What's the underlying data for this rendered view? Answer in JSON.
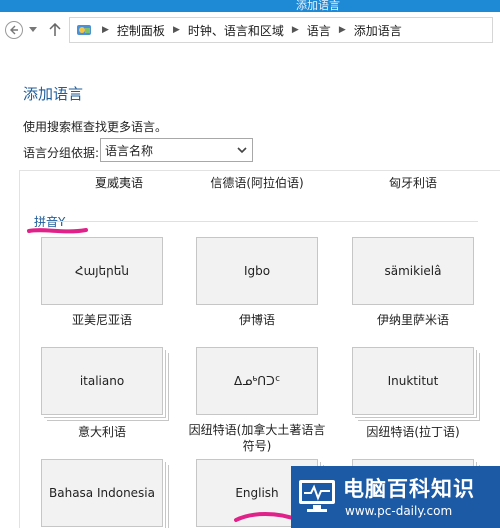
{
  "window": {
    "title": "添加语言"
  },
  "address_bar": {
    "crumbs": [
      "控制面板",
      "时钟、语言和区域",
      "语言",
      "添加语言"
    ]
  },
  "page": {
    "heading": "添加语言",
    "hint": "使用搜索框查找更多语言。",
    "group_by_label": "语言分组依据:",
    "group_by_value": "语言名称"
  },
  "list": {
    "top_row_captions": [
      "夏威夷语",
      "信德语(阿拉伯语)",
      "匈牙利语"
    ],
    "group_header": "拼音Y",
    "rows": [
      [
        {
          "native": "Հայերեն",
          "caption": "亚美尼亚语"
        },
        {
          "native": "Igbo",
          "caption": "伊博语"
        },
        {
          "native": "sämikielâ",
          "caption": "伊纳里萨米语"
        }
      ],
      [
        {
          "native": "italiano",
          "caption": "意大利语"
        },
        {
          "native": "ᐃᓄᒃᑎᑐᑦ",
          "caption_line1": "因纽特语(加拿大土著语言",
          "caption_line2": "符号)"
        },
        {
          "native": "Inuktitut",
          "caption": "因纽特语(拉丁语)"
        }
      ],
      [
        {
          "native": "Bahasa Indonesia"
        },
        {
          "native": "English"
        },
        {
          "native": ""
        }
      ]
    ]
  },
  "watermark": {
    "brand": "电脑百科知识",
    "url": "www.pc-daily.com"
  },
  "colors": {
    "accent": "#1e5c9a",
    "tile_bg": "#f2f2f2",
    "selection": "#dde9f6",
    "watermark_bg": "#1c5aa6",
    "annotation": "#e0218a"
  }
}
